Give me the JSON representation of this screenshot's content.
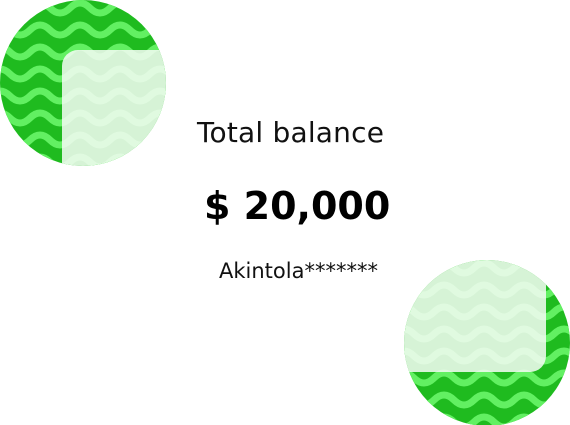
{
  "balance_card": {
    "title": "Total balance",
    "amount": "$ 20,000",
    "account_name": "Akintola*******"
  },
  "decor": {
    "icon": "wavy-green-circle",
    "colors": {
      "dark_green": "#1fbb1f",
      "light_green": "#62f062",
      "frost": "#f5fcf5"
    }
  }
}
